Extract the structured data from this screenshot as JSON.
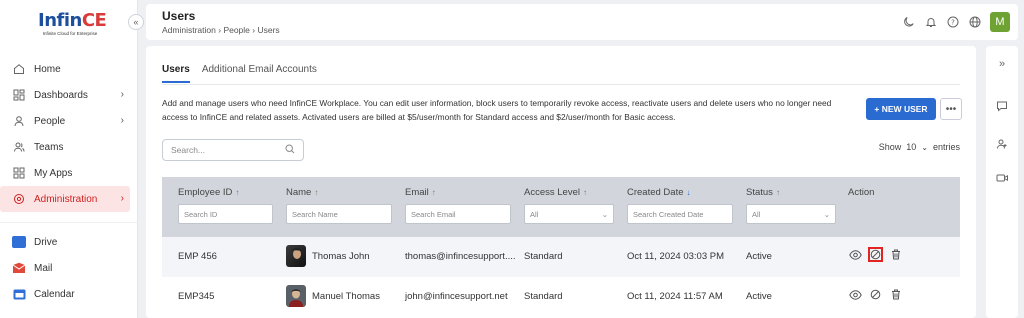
{
  "brand": {
    "name_main": "Infin",
    "name_accent": "CE",
    "tagline": "Infinite Cloud for Enterprise"
  },
  "sidebar": {
    "collapse_icon": "chevrons-left-icon",
    "items": [
      {
        "label": "Home",
        "icon": "home-icon"
      },
      {
        "label": "Dashboards",
        "icon": "dashboard-icon",
        "has_chevron": true
      },
      {
        "label": "People",
        "icon": "person-icon",
        "has_chevron": true
      },
      {
        "label": "Teams",
        "icon": "teams-icon"
      },
      {
        "label": "My Apps",
        "icon": "apps-icon"
      },
      {
        "label": "Administration",
        "icon": "admin-icon",
        "has_chevron": true,
        "active": true
      }
    ],
    "apps": [
      {
        "label": "Drive",
        "icon": "drive-icon",
        "color": "#2f6fd6"
      },
      {
        "label": "Mail",
        "icon": "mail-icon",
        "color": "#e04a3c"
      },
      {
        "label": "Calendar",
        "icon": "calendar-icon",
        "color": "#2f6fd6"
      }
    ]
  },
  "header": {
    "title": "Users",
    "breadcrumb": [
      "Administration",
      "People",
      "Users"
    ],
    "icons": [
      "moon-icon",
      "bell-icon",
      "help-icon",
      "globe-icon"
    ],
    "avatar_letter": "M",
    "avatar_color": "#6ea232"
  },
  "rail": {
    "icons": [
      "chevrons-right-icon",
      "chat-icon",
      "contacts-icon",
      "video-icon"
    ]
  },
  "tabs": [
    "Users",
    "Additional Email Accounts"
  ],
  "description": "Add and manage users who need InfinCE Workplace. You can edit user information, block users to temporarily revoke access, reactivate users and delete users who no longer need access to InfinCE and related assets. Activated users are billed at  $5/user/month for Standard access and $2/user/month for Basic access.",
  "new_user_label": "+ NEW USER",
  "search_placeholder": "Search...",
  "entries": {
    "show_label": "Show",
    "value": "10",
    "suffix": "entries"
  },
  "table": {
    "columns": [
      {
        "label": "Employee ID",
        "sort": "↑",
        "filter": "Search ID"
      },
      {
        "label": "Name",
        "sort": "↑",
        "filter": "Search Name"
      },
      {
        "label": "Email",
        "sort": "↑",
        "filter": "Search Email"
      },
      {
        "label": "Access Level",
        "sort": "↑",
        "filter": "All",
        "select": true
      },
      {
        "label": "Created Date",
        "sort": "↓",
        "filter": "Search Created Date",
        "sorted": true
      },
      {
        "label": "Status",
        "sort": "↑",
        "filter": "All",
        "select": true
      },
      {
        "label": "Action"
      }
    ],
    "rows": [
      {
        "id": "EMP 456",
        "name": "Thomas John",
        "email": "thomas@infincesupport....",
        "access": "Standard",
        "created": "Oct 11, 2024 03:03 PM",
        "status": "Active"
      },
      {
        "id": "EMP345",
        "name": "Manuel Thomas",
        "email": "john@infincesupport.net",
        "access": "Standard",
        "created": "Oct 11, 2024 11:57 AM",
        "status": "Active"
      }
    ],
    "action_icons": [
      "eye-icon",
      "block-icon",
      "trash-icon"
    ]
  },
  "colors": {
    "accent": "#2a6bd1",
    "active_nav": "#fde4e4",
    "highlight": "#e32222"
  }
}
